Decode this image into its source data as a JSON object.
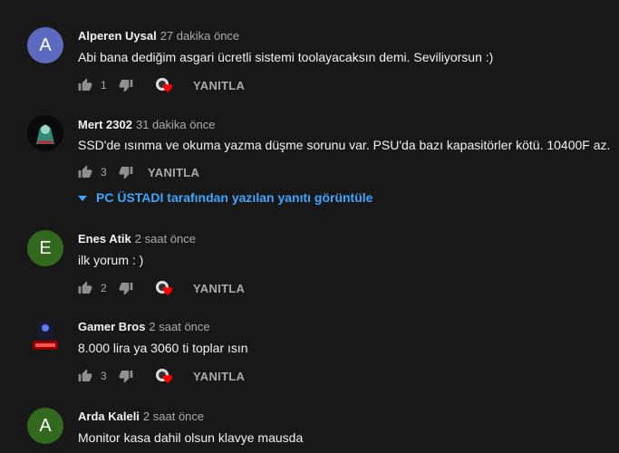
{
  "comments": [
    {
      "author": "Alperen Uysal",
      "time": "27 dakika önce",
      "text": "Abi bana dediğim asgari ücretli sistemi toolayacaksın demi. Seviliyorsun :)",
      "likes": "1",
      "avatar_letter": "A",
      "avatar_color": "#5c6bc0",
      "reply": "YANITLA"
    },
    {
      "author": "Mert 2302",
      "time": "31 dakika önce",
      "text": "SSD'de ısınma ve okuma yazma düşme sorunu var. PSU'da bazı kapasitörler kötü. 10400F az.",
      "likes": "3",
      "reply": "YANITLA",
      "view_replies": "PC ÜSTADI tarafından yazılan yanıtı görüntüle"
    },
    {
      "author": "Enes Atik",
      "time": "2 saat önce",
      "text": "ilk yorum : )",
      "likes": "2",
      "avatar_letter": "E",
      "avatar_color": "#33691e",
      "reply": "YANITLA"
    },
    {
      "author": "Gamer Bros",
      "time": "2 saat önce",
      "text": "8.000 lira ya 3060 ti toplar ısın",
      "likes": "3",
      "reply": "YANITLA"
    },
    {
      "author": "Arda Kaleli",
      "time": "2 saat önce",
      "text": "Monitor kasa dahil olsun klavye mausda",
      "avatar_letter": "A",
      "avatar_color": "#33691e"
    }
  ],
  "colors": {
    "background": "#181818",
    "link": "#3ea6ff",
    "heart": "#ff0000"
  },
  "icons": {
    "like": "thumb-up-icon",
    "dislike": "thumb-down-icon",
    "creator_heart": "creator-heart-icon",
    "expand": "caret-down-icon"
  }
}
